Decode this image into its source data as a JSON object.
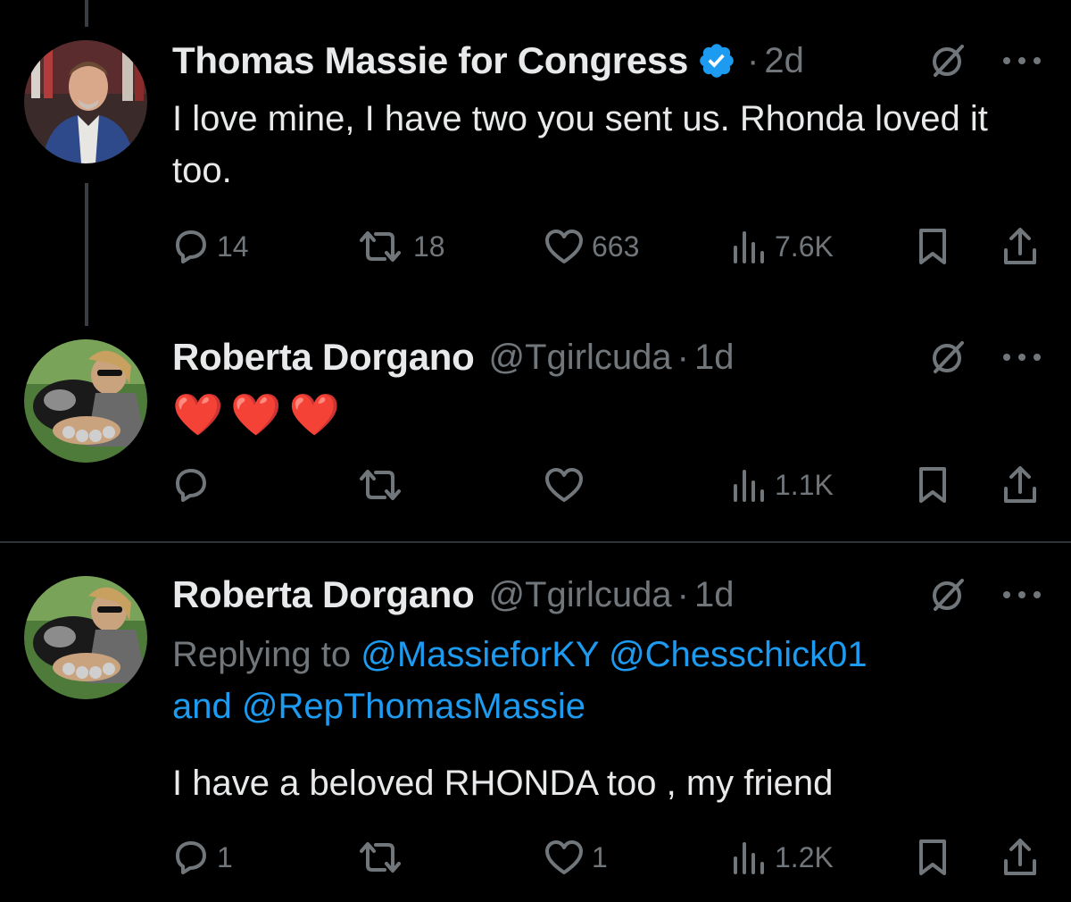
{
  "tweets": [
    {
      "name": "Thomas Massie for Congress",
      "verified": true,
      "time_sep": "·",
      "time": "2d",
      "text": "I love mine, I have two you sent us. Rhonda loved it too.",
      "stats": {
        "replies": "14",
        "reposts": "18",
        "likes": "663",
        "views": "7.6K"
      }
    },
    {
      "name": "Roberta Dorgano",
      "handle": "@Tgirlcuda",
      "time_sep": "·",
      "time": "1d",
      "text": "❤️❤️❤️",
      "stats": {
        "replies": "",
        "reposts": "",
        "likes": "",
        "views": "1.1K"
      }
    },
    {
      "name": "Roberta Dorgano",
      "handle": "@Tgirlcuda",
      "time_sep": "·",
      "time": "1d",
      "replying_prefix": "Replying to",
      "mention_1": "@MassieforKY",
      "mention_2": "@Chesschick01",
      "mention_and": "and",
      "mention_3": "@RepThomasMassie",
      "text": "I have a beloved RHONDA too , my friend",
      "stats": {
        "replies": "1",
        "reposts": "",
        "likes": "1",
        "views": "1.2K"
      }
    }
  ],
  "icons": [
    "reply-icon",
    "repost-icon",
    "like-icon",
    "views-icon",
    "bookmark-icon",
    "share-icon",
    "grok-icon",
    "more-icon",
    "verified-icon"
  ],
  "colors": {
    "background": "#000000",
    "text": "#e7e9ea",
    "muted": "#71767b",
    "link": "#1d9bf0",
    "verified": "#1d9bf0",
    "heart": "#f0284a"
  }
}
